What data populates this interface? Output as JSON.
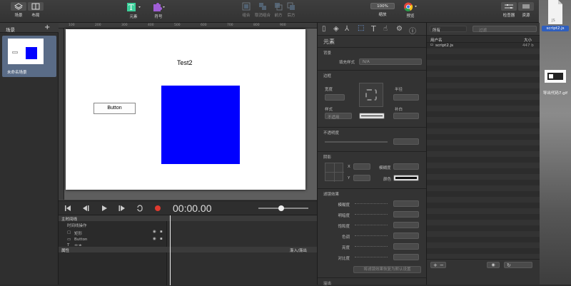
{
  "toolbar": {
    "scenes_label": "场景",
    "layout_label": "布局",
    "elements_label": "元素",
    "symbols_label": "符号",
    "group1": "组合",
    "group2": "取消组合",
    "group3": "前方",
    "group4": "后方",
    "zoom_value": "100%",
    "zoom_label": "缩放",
    "preview_label": "预览",
    "inspector_label": "检查器",
    "resources_label": "资源"
  },
  "scenes_panel": {
    "title": "场景",
    "add": "+",
    "scene_name": "未命名场景"
  },
  "stage": {
    "title_text": "Test2",
    "button_text": "Button",
    "box_color": "#0000ff",
    "ruler_marks": [
      "100",
      "200",
      "300",
      "400",
      "500",
      "600",
      "700",
      "800",
      "900"
    ]
  },
  "timeline": {
    "time": "00:00.00",
    "main_timeline": "主时间线",
    "timeline_actions": "时间线操作",
    "layers": [
      "矩形",
      "Button",
      "文本"
    ],
    "properties": "属性",
    "ease": "渐入/渐出"
  },
  "inspector": {
    "section_title": "元素",
    "bg_section": "背景",
    "fill_style_label": "填充样式",
    "fill_style_value": "N/A",
    "border_section": "边框",
    "width_label": "宽度",
    "radius_label": "半径",
    "style_label": "样式",
    "style_value": "不适用",
    "padding_label": "补白",
    "opacity_section": "不透明度",
    "shadow_section": "阴影",
    "x_label": "X",
    "y_label": "Y",
    "blur_label": "模糊度",
    "color_label": "颜色",
    "filter_section": "滤镜效果",
    "filters": [
      "模糊度",
      "明暗度",
      "饱和度",
      "色调",
      "亮度",
      "对比度"
    ],
    "reset_button": "将滤镜效果恢复为默认设置",
    "bottom_section": "溢出"
  },
  "resources": {
    "filter": "所有",
    "search_placeholder": "过滤",
    "col_name": "用户名",
    "col_size": "大小",
    "file_name": "script2.js",
    "file_size": "447 b",
    "add": "+",
    "remove": "−"
  },
  "desktop": {
    "file1": "script2.js",
    "file2": "导出代码7.gif"
  },
  "colors": {
    "accent": "#0000ff",
    "record": "#e03a2f"
  }
}
